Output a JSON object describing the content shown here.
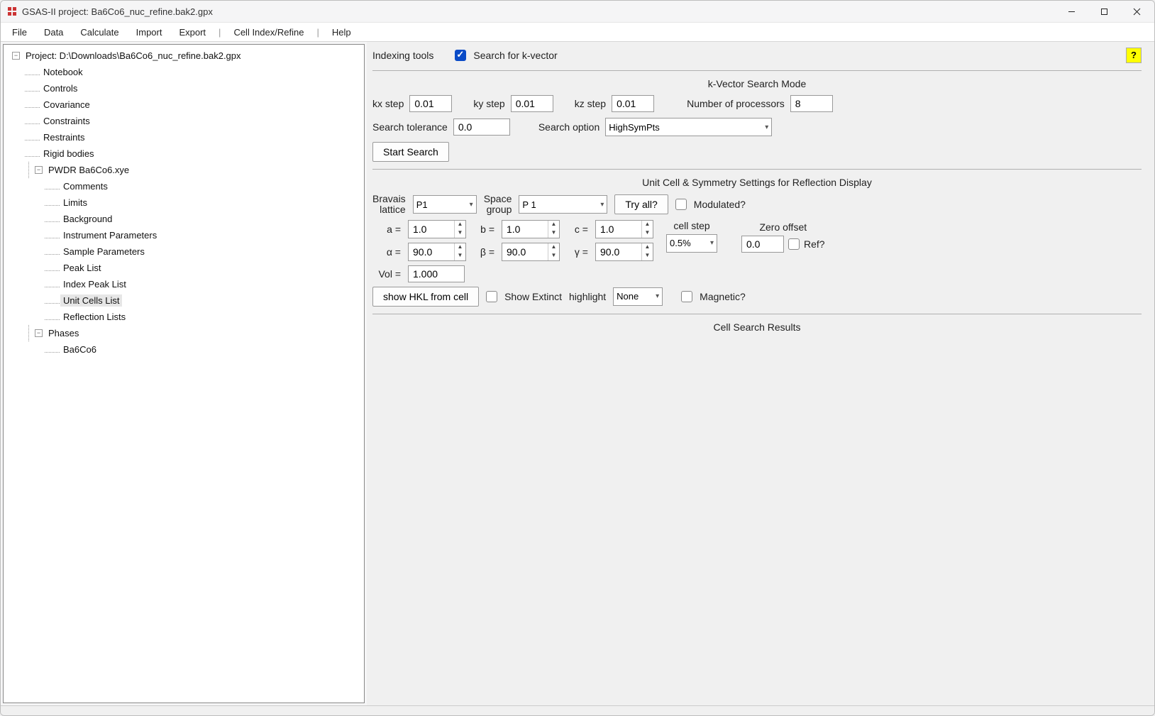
{
  "window": {
    "title": "GSAS-II project: Ba6Co6_nuc_refine.bak2.gpx"
  },
  "menu": {
    "file": "File",
    "data": "Data",
    "calculate": "Calculate",
    "import": "Import",
    "export": "Export",
    "cell": "Cell Index/Refine",
    "help": "Help"
  },
  "tree": {
    "project": "Project: D:\\Downloads\\Ba6Co6_nuc_refine.bak2.gpx",
    "notebook": "Notebook",
    "controls": "Controls",
    "covariance": "Covariance",
    "constraints": "Constraints",
    "restraints": "Restraints",
    "rigid": "Rigid bodies",
    "pwdr": "PWDR Ba6Co6.xye",
    "comments": "Comments",
    "limits": "Limits",
    "background": "Background",
    "instparams": "Instrument Parameters",
    "sampparams": "Sample Parameters",
    "peaklist": "Peak List",
    "indexpeak": "Index Peak List",
    "unitcells": "Unit Cells List",
    "refl": "Reflection Lists",
    "phases": "Phases",
    "phase1": "Ba6Co6"
  },
  "panel": {
    "indexing": "Indexing tools",
    "searchk_label": "Search for k-vector",
    "kvec_head": "k-Vector Search Mode",
    "kx": "kx step",
    "kx_v": "0.01",
    "ky": "ky step",
    "ky_v": "0.01",
    "kz": "kz step",
    "kz_v": "0.01",
    "nproc": "Number of processors",
    "nproc_v": "8",
    "tol": "Search tolerance",
    "tol_v": "0.0",
    "sopt": "Search option",
    "sopt_v": "HighSymPts",
    "start": "Start Search",
    "ucell_head": "Unit Cell & Symmetry Settings for Reflection Display",
    "bravais": "Bravais",
    "bravais2": "lattice",
    "bravais_v": "P1",
    "spg": "Space",
    "spg2": "group",
    "spg_v": "P 1",
    "tryall": "Try all?",
    "modulated": "Modulated?",
    "a": "a = ",
    "a_v": "1.0",
    "b": "b = ",
    "b_v": "1.0",
    "c": "c = ",
    "c_v": "1.0",
    "alpha": "α = ",
    "alpha_v": "90.0",
    "beta": "β = ",
    "beta_v": "90.0",
    "gamma": "γ = ",
    "gamma_v": "90.0",
    "vol": "Vol = ",
    "vol_v": "1.000",
    "cellstep": "cell step",
    "cellstep_v": "0.5%",
    "zoff": "Zero offset",
    "zoff_v": "0.0",
    "ref": "Ref?",
    "showhkl": "show HKL from cell",
    "showext": "Show Extinct",
    "highlight": "highlight",
    "highlight_v": "None",
    "magnetic": "Magnetic?",
    "cellres": "Cell Search Results"
  }
}
